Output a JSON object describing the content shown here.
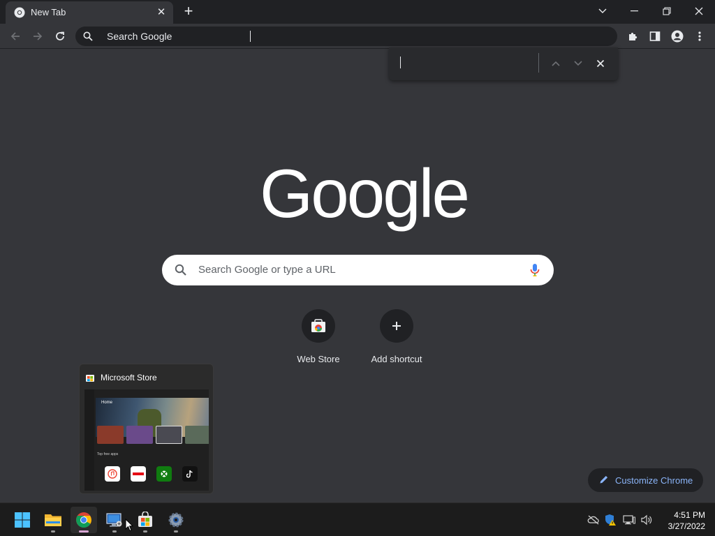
{
  "tab": {
    "title": "New Tab"
  },
  "omnibox": {
    "text": "Search Google"
  },
  "logo": {
    "text": "Google"
  },
  "search": {
    "placeholder": "Search Google or type a URL"
  },
  "shortcuts": [
    {
      "label": "Web Store"
    },
    {
      "label": "Add shortcut"
    }
  ],
  "preview": {
    "title": "Microsoft Store",
    "thumb": {
      "home_label": "Home",
      "row_label": "Top free apps"
    }
  },
  "customize": {
    "label": "Customize Chrome"
  },
  "taskbar": {
    "time": "4:51 PM",
    "date": "3/27/2022"
  },
  "colors": {
    "background": "#35363a",
    "tabstrip": "#202124",
    "accent": "#8ab4f8"
  }
}
